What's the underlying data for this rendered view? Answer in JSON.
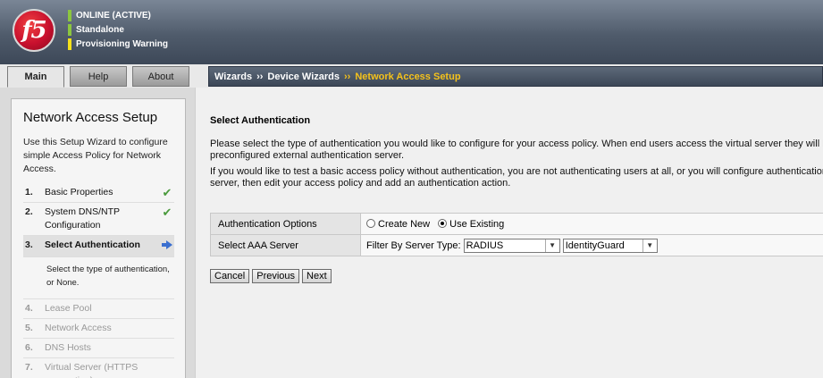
{
  "header": {
    "logo_text": "f5",
    "status": [
      {
        "text": "ONLINE (ACTIVE)",
        "color": "#8cc63f"
      },
      {
        "text": "Standalone",
        "color": "#8cc63f"
      },
      {
        "text": "Provisioning Warning",
        "color": "#f5e11b"
      }
    ]
  },
  "tabs": [
    {
      "label": "Main",
      "active": true
    },
    {
      "label": "Help",
      "active": false
    },
    {
      "label": "About",
      "active": false
    }
  ],
  "breadcrumb": {
    "items": [
      "Wizards",
      "Device Wizards",
      "Network Access Setup"
    ],
    "separator": "››"
  },
  "sidebar": {
    "title": "Network Access Setup",
    "description": "Use this Setup Wizard to configure simple Access Policy for Network Access.",
    "steps": [
      {
        "num": "1.",
        "label": "Basic Properties",
        "state": "done"
      },
      {
        "num": "2.",
        "label": "System DNS/NTP Configuration",
        "state": "done"
      },
      {
        "num": "3.",
        "label": "Select Authentication",
        "state": "current",
        "detail": "Select the type of authentication, or None."
      },
      {
        "num": "4.",
        "label": "Lease Pool",
        "state": "disabled"
      },
      {
        "num": "5.",
        "label": "Network Access",
        "state": "disabled"
      },
      {
        "num": "6.",
        "label": "DNS Hosts",
        "state": "disabled"
      },
      {
        "num": "7.",
        "label": "Virtual Server (HTTPS connection)",
        "state": "disabled"
      }
    ]
  },
  "main": {
    "section_title": "Select Authentication",
    "paragraph1_line1": "Please select the type of authentication you would like to configure for your access policy. When end users access the virtual server they will be",
    "paragraph1_line2": "preconfigured external authentication server.",
    "paragraph2_line1": "If you would like to test a basic access policy without authentication, you are not authenticating users at all, or you will configure authentication la",
    "paragraph2_line2": "server, then edit your access policy and add an authentication action.",
    "auth_options": {
      "label": "Authentication Options",
      "create_new": "Create New",
      "use_existing": "Use Existing",
      "selected": "use_existing"
    },
    "aaa_server": {
      "label": "Select AAA Server",
      "filter_label": "Filter By Server Type:",
      "server_type": "RADIUS",
      "server": "IdentityGuard"
    },
    "buttons": {
      "cancel": "Cancel",
      "previous": "Previous",
      "next": "Next"
    }
  }
}
